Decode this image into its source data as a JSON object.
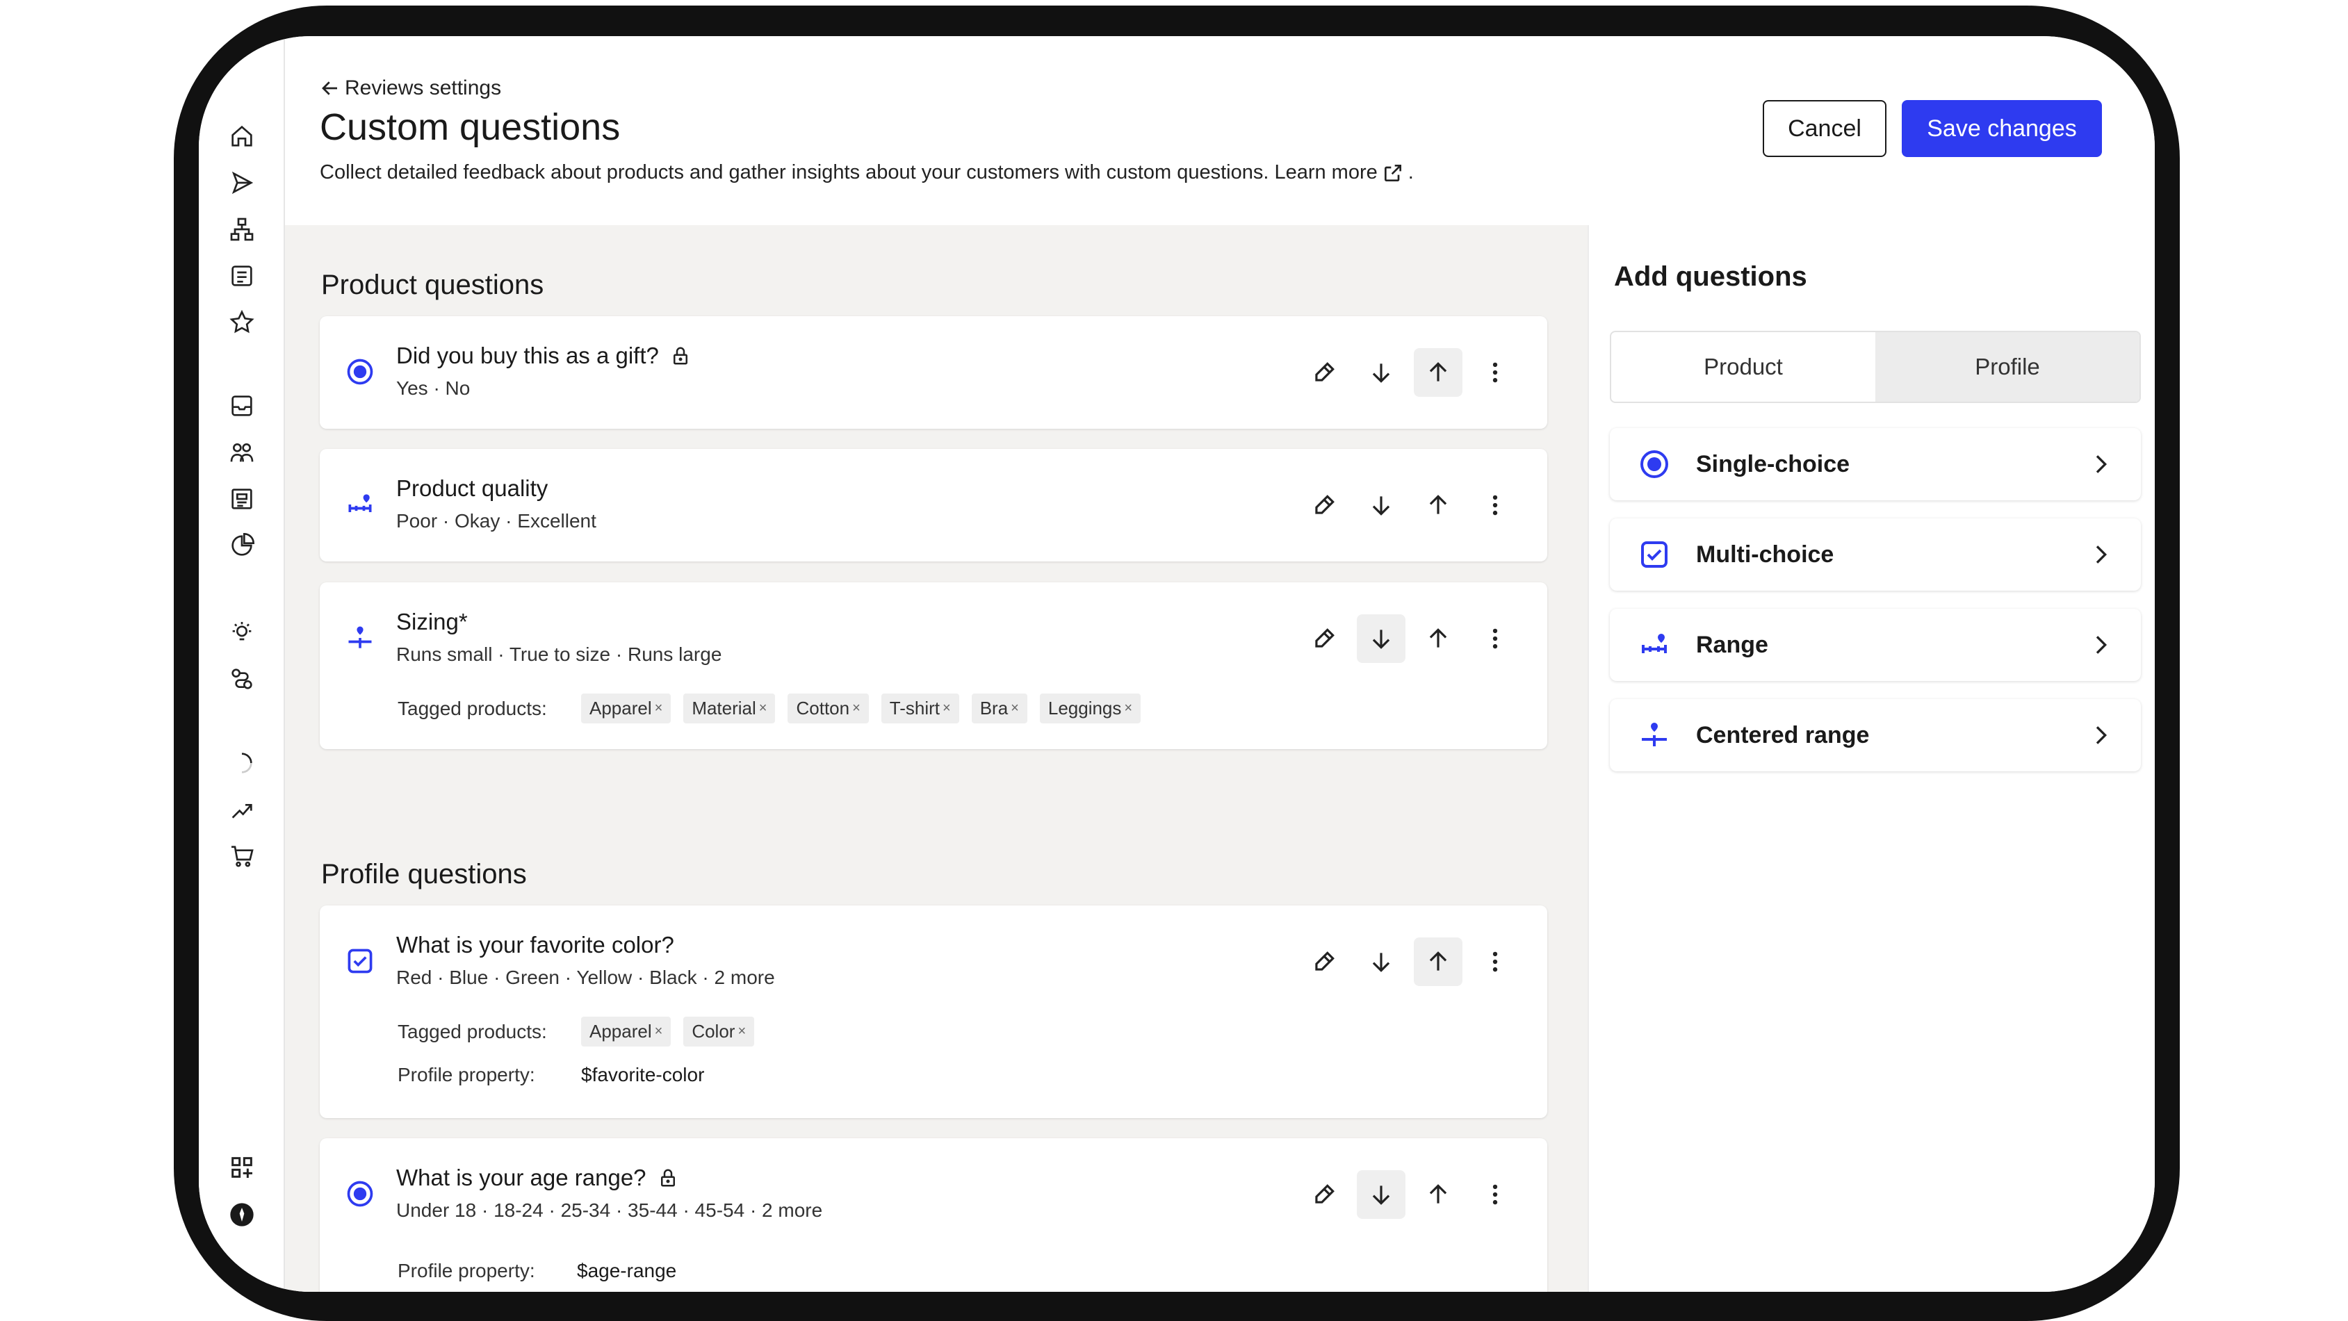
{
  "header": {
    "back_label": "Reviews settings",
    "title": "Custom questions",
    "description": "Collect detailed feedback about products and gather insights about your customers with custom questions. Learn more",
    "description_end": ".",
    "cancel_label": "Cancel",
    "save_label": "Save changes"
  },
  "sidebar": {
    "items": [
      "home-icon",
      "send-icon",
      "flow-icon",
      "list-icon",
      "star-icon",
      "inbox-icon",
      "audience-icon",
      "content-icon",
      "analytics-icon",
      "lightbulb-icon",
      "integrations-icon",
      "loading-icon",
      "trend-icon",
      "cart-icon",
      "apps-icon",
      "account-icon"
    ]
  },
  "product_section": {
    "title": "Product questions",
    "questions": [
      {
        "title": "Did you buy this as a gift?",
        "options": "Yes · No",
        "type": "single-choice",
        "locked": true
      },
      {
        "title": "Product quality",
        "options": "Poor · Okay · Excellent",
        "type": "range"
      },
      {
        "title": "Sizing*",
        "options": "Runs small · True to size · Runs large",
        "type": "centered-range",
        "tagged_label": "Tagged products:",
        "tags": [
          "Apparel",
          "Material",
          "Cotton",
          "T-shirt",
          "Bra",
          "Leggings"
        ]
      }
    ]
  },
  "profile_section": {
    "title": "Profile questions",
    "questions": [
      {
        "title": "What is your favorite color?",
        "options": "Red · Blue · Green · Yellow · Black · 2 more",
        "type": "multi-choice",
        "tagged_label": "Tagged products:",
        "tags": [
          "Apparel",
          "Color"
        ],
        "property_label": "Profile property:",
        "property": "$favorite-color"
      },
      {
        "title": "What is your age range?",
        "options": "Under 18 · 18-24 · 25-34 · 35-44 · 45-54 · 2 more",
        "type": "single-choice",
        "locked": true,
        "property_label": "Profile property:",
        "property": "$age-range"
      }
    ]
  },
  "add_panel": {
    "title": "Add questions",
    "tabs": [
      {
        "label": "Product",
        "selected": false
      },
      {
        "label": "Profile",
        "selected": true
      }
    ],
    "types": [
      {
        "label": "Single-choice",
        "icon": "radio-icon"
      },
      {
        "label": "Multi-choice",
        "icon": "checkbox-icon"
      },
      {
        "label": "Range",
        "icon": "range-icon"
      },
      {
        "label": "Centered range",
        "icon": "centered-range-icon"
      }
    ]
  },
  "colors": {
    "accent": "#2e3bf0",
    "background": "#f3f2f0"
  }
}
